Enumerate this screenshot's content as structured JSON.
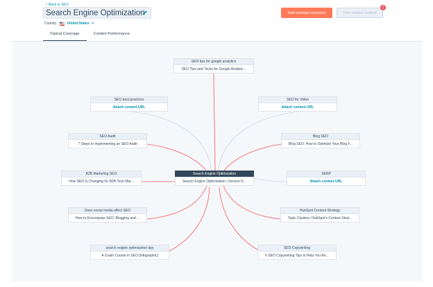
{
  "header": {
    "back_label": "Back to SEO",
    "title": "Search Engine Optimization",
    "country_label": "Country",
    "country_value": "United States",
    "add_subtopic_label": "Add subtopic keyword",
    "find_content_label": "Find related content",
    "find_badge_count": "1"
  },
  "tabs": [
    {
      "label": "Topical Coverage",
      "active": true
    },
    {
      "label": "Content Performance",
      "active": false
    }
  ],
  "colors": {
    "accent": "#ff7a59",
    "link": "#0091ae",
    "edge_linked": "#f2545b",
    "edge_unlinked": "#cbd6e2",
    "dark": "#33475b"
  },
  "center_node": {
    "keyword": "Search Engine Optimization",
    "content": "Search Engine Optimization | Service D..."
  },
  "nodes": {
    "seo_tips_analytics": {
      "keyword": "SEO tips for google analytics",
      "content": "SEO Tips and Tricks for Google Analytic..."
    },
    "seo_best_practices": {
      "keyword": "SEO best practices",
      "content": "Attach content URL"
    },
    "seo_for_video": {
      "keyword": "SEO for Video",
      "content": "Attach content URL"
    },
    "seo_audit": {
      "keyword": "SEO Audit",
      "content": "7 Steps to Implementing an SEO Audit"
    },
    "blog_seo": {
      "keyword": "Blog SEO",
      "content": "Blog SEO: How to Optimize Your Blog F..."
    },
    "b2b_marketing_seo": {
      "keyword": "B2B Marketing SEO",
      "content": "How SEO is Changing for B2B Tech Mar..."
    },
    "serp": {
      "keyword": "SERP",
      "content": "Attach content URL"
    },
    "social_media_seo": {
      "keyword": "Does social media affect SEO",
      "content": "How to Encompass SEO, Blogging and ..."
    },
    "hubspot_content_strategy": {
      "keyword": "HubSpot Content Strategy",
      "content": "Topic Clusters, HubSpot's Content Strat..."
    },
    "seo_tips": {
      "keyword": "search engine optimization tips",
      "content": "A Crash Course in SEO [Infographic]"
    },
    "seo_copywriting": {
      "keyword": "SEO Copywriting",
      "content": "6 SEO Copywriting Tips to Help You Re..."
    }
  }
}
